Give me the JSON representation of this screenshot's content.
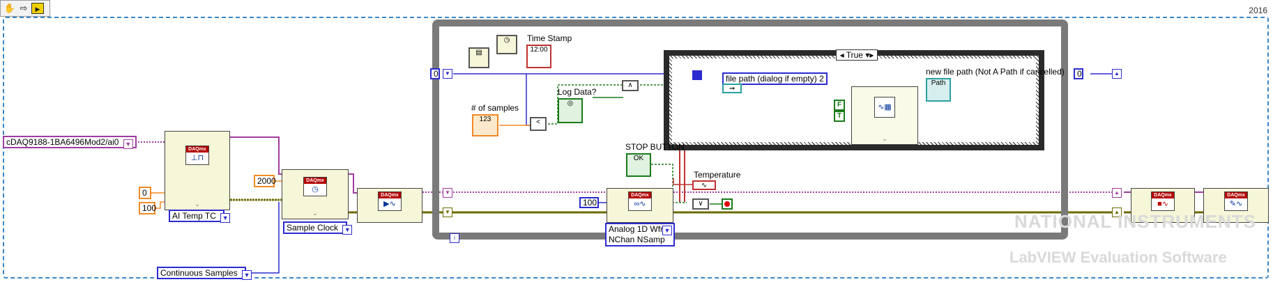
{
  "toolbar": {
    "icons": [
      "hand-icon",
      "arrow-icon",
      "run-icon"
    ]
  },
  "version": "2016",
  "controls": {
    "channel": "cDAQ9188-1BA6496Mod2/ai0",
    "min_value": "0",
    "max_value": "100",
    "rate": "2000",
    "sample_mode": "Continuous Samples",
    "samples_per_read": "100",
    "loop_shift_left": "0",
    "loop_shift_right": "0"
  },
  "vis": {
    "create_channel_selector": "AI Temp TC",
    "timing_selector": "Sample Clock",
    "read_selector_line1": "Analog 1D Wfm",
    "read_selector_line2": "NChan NSamp",
    "daqmx_badge": "DAQmx"
  },
  "labels": {
    "time_stamp": "Time Stamp",
    "samples": "# of samples",
    "log_data": "Log Data?",
    "stop_button": "STOP BUTTON",
    "temperature": "Temperature",
    "file_path": "file path (dialog if empty) 2",
    "new_file_path": "new file path (Not A Path if cancelled)"
  },
  "case_structure": {
    "selector": "True"
  },
  "constants": {
    "false_const": "F",
    "true_const": "T",
    "loop_iteration": "i"
  },
  "watermark": {
    "line1": "NATIONAL INSTRUMENTS",
    "line2": "LabVIEW Evaluation Software"
  },
  "colors": {
    "dbl_wire": "#f08a24",
    "string_wire": "#a03ca0",
    "int_wire": "#2b2bd0",
    "bool_wire": "#1a7a1a",
    "task_wire": "#6b6b00",
    "path_wire": "#2aa0a0",
    "error_wire": "#c03030"
  }
}
